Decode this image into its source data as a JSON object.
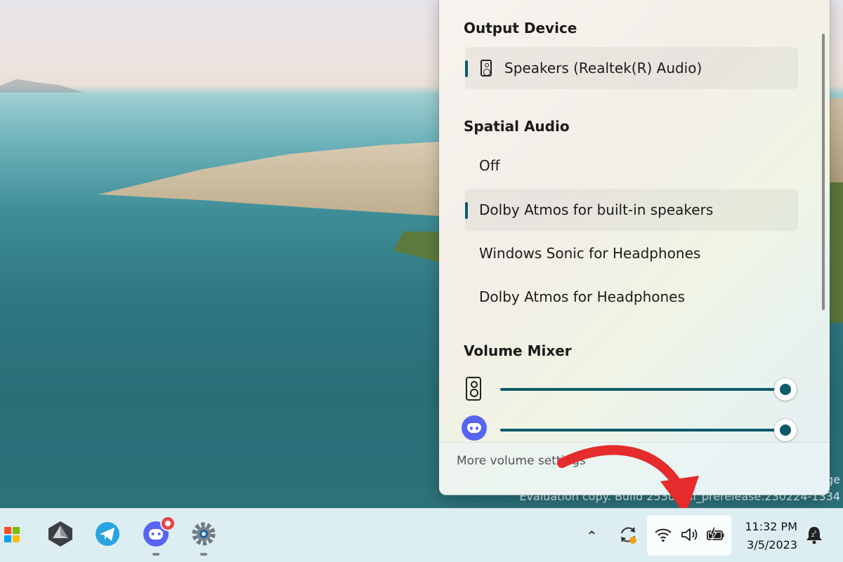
{
  "desktop": {
    "watermark_line1": "ge",
    "watermark_line2": "Evaluation copy. Build 25309.ni_prerelease.230224-1334"
  },
  "flyout": {
    "output_device_title": "Output Device",
    "output_device": "Speakers (Realtek(R) Audio)",
    "spatial_audio_title": "Spatial Audio",
    "spatial_options": [
      {
        "label": "Off",
        "selected": false
      },
      {
        "label": "Dolby Atmos for built-in speakers",
        "selected": true
      },
      {
        "label": "Windows Sonic for Headphones",
        "selected": false
      },
      {
        "label": "Dolby Atmos for Headphones",
        "selected": false
      }
    ],
    "volume_mixer_title": "Volume Mixer",
    "mixer": [
      {
        "app": "speaker-icon",
        "volume_fraction": 1.0
      },
      {
        "app": "discord-icon",
        "volume_fraction": 1.0
      }
    ],
    "more_settings": "More volume settings"
  },
  "taskbar": {
    "icons": [
      "windows-start-icon",
      "prism-icon",
      "telegram-icon",
      "discord-icon",
      "settings-icon"
    ],
    "clock_time": "11:32 PM",
    "clock_date": "3/5/2023"
  },
  "colors": {
    "accent": "#0f5a68",
    "arrow": "#e52b2b",
    "discord": "#5865f2",
    "telegram": "#2aa3e0"
  }
}
